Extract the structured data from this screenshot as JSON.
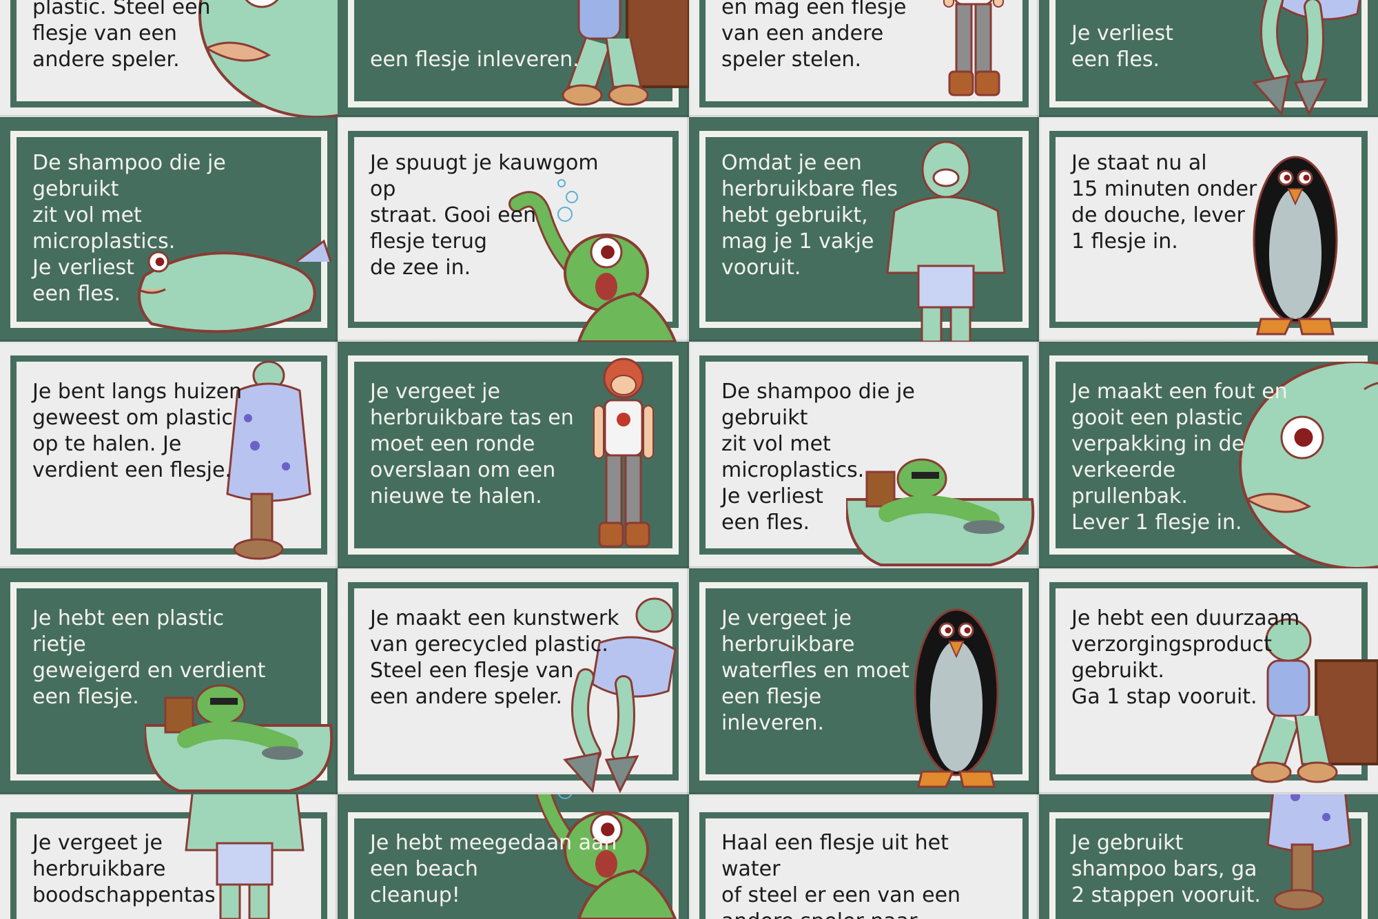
{
  "colors": {
    "card_green": "#466e5e",
    "card_white": "#ededed",
    "text_dark": "#1b1b1b",
    "text_light": "#f3f3ee",
    "creature_mint": "#9fd5b8",
    "creature_green": "#6db858",
    "outline_red": "#8a3b34"
  },
  "cards": [
    {
      "variant": "white",
      "text": "plastic. Steel een\nflesje van een\nandere speler.",
      "art": "fish-head-icon",
      "partial": "top"
    },
    {
      "variant": "green",
      "text": "een flesje inleveren.",
      "art": "sitting-fisher-icon",
      "partial": "top"
    },
    {
      "variant": "white",
      "text": "en mag een flesje\nvan een andere\nspeler stelen.",
      "art": "standing-kid-icon",
      "partial": "top"
    },
    {
      "variant": "green",
      "text": "Je verliest\neen fles.",
      "art": "diver-fins-icon",
      "partial": "top"
    },
    {
      "variant": "green",
      "text": "De shampoo die je gebruikt\nzit vol met microplastics.\nJe verliest\neen fles.",
      "art": "bloated-fish-icon"
    },
    {
      "variant": "white",
      "text": "Je spuugt je kauwgom op\nstraat. Gooi een\nflesje terug\nde zee in.",
      "art": "swimming-alien-icon"
    },
    {
      "variant": "green",
      "text": "Omdat je een\nherbruikbare fles\nhebt gebruikt,\nmag je 1 vakje\nvooruit.",
      "art": "muscle-fishman-icon"
    },
    {
      "variant": "white",
      "text": "Je staat nu al\n15 minuten onder\nde douche, lever\n1 flesje in.",
      "art": "penguin-icon"
    },
    {
      "variant": "white",
      "text": "Je bent langs huizen\ngeweest om plastic\nop te halen. Je\nverdient een flesje.",
      "art": "hooded-fisher-icon"
    },
    {
      "variant": "green",
      "text": "Je vergeet je\nherbruikbare tas en\nmoet een ronde\noverslaan om een\nnieuwe te halen.",
      "art": "standing-kid-icon"
    },
    {
      "variant": "white",
      "text": "De shampoo die je gebruikt\nzit vol met microplastics.\nJe verliest\neen fles.",
      "art": "bathtub-frog-icon"
    },
    {
      "variant": "green",
      "text": "Je maakt een fout en\ngooit een plastic\nverpakking in de\nverkeerde\nprullenbak.\nLever 1 flesje in.",
      "art": "fish-head-icon"
    },
    {
      "variant": "green",
      "text": "Je hebt een plastic rietje\ngeweigerd en verdient\neen flesje.",
      "art": "bathtub-frog-icon"
    },
    {
      "variant": "white",
      "text": "Je maakt een kunstwerk\nvan gerecycled plastic.\nSteel een flesje van\neen andere speler.",
      "art": "diver-fins-icon"
    },
    {
      "variant": "green",
      "text": "Je vergeet je\nherbruikbare\nwaterfles en moet\neen flesje\ninleveren.",
      "art": "penguin-icon"
    },
    {
      "variant": "white",
      "text": "Je hebt een duurzaam\nverzorgingsproduct\ngebruikt.\nGa 1 stap vooruit.",
      "art": "sitting-fisher-icon"
    },
    {
      "variant": "white",
      "text": "Je vergeet je\nherbruikbare\nboodschappentas",
      "art": "muscle-fishman-icon",
      "partial": "bottom"
    },
    {
      "variant": "green",
      "text": "Je hebt meegedaan aan\neen beach\ncleanup!",
      "art": "swimming-alien-icon",
      "partial": "bottom"
    },
    {
      "variant": "white",
      "text": "Haal een flesje uit het water\nof steel er een van een\nandere speler naar",
      "art": "none",
      "partial": "bottom"
    },
    {
      "variant": "green",
      "text": "Je gebruikt\nshampoo bars, ga\n2 stappen vooruit.",
      "art": "hooded-fisher-icon",
      "partial": "bottom"
    }
  ]
}
